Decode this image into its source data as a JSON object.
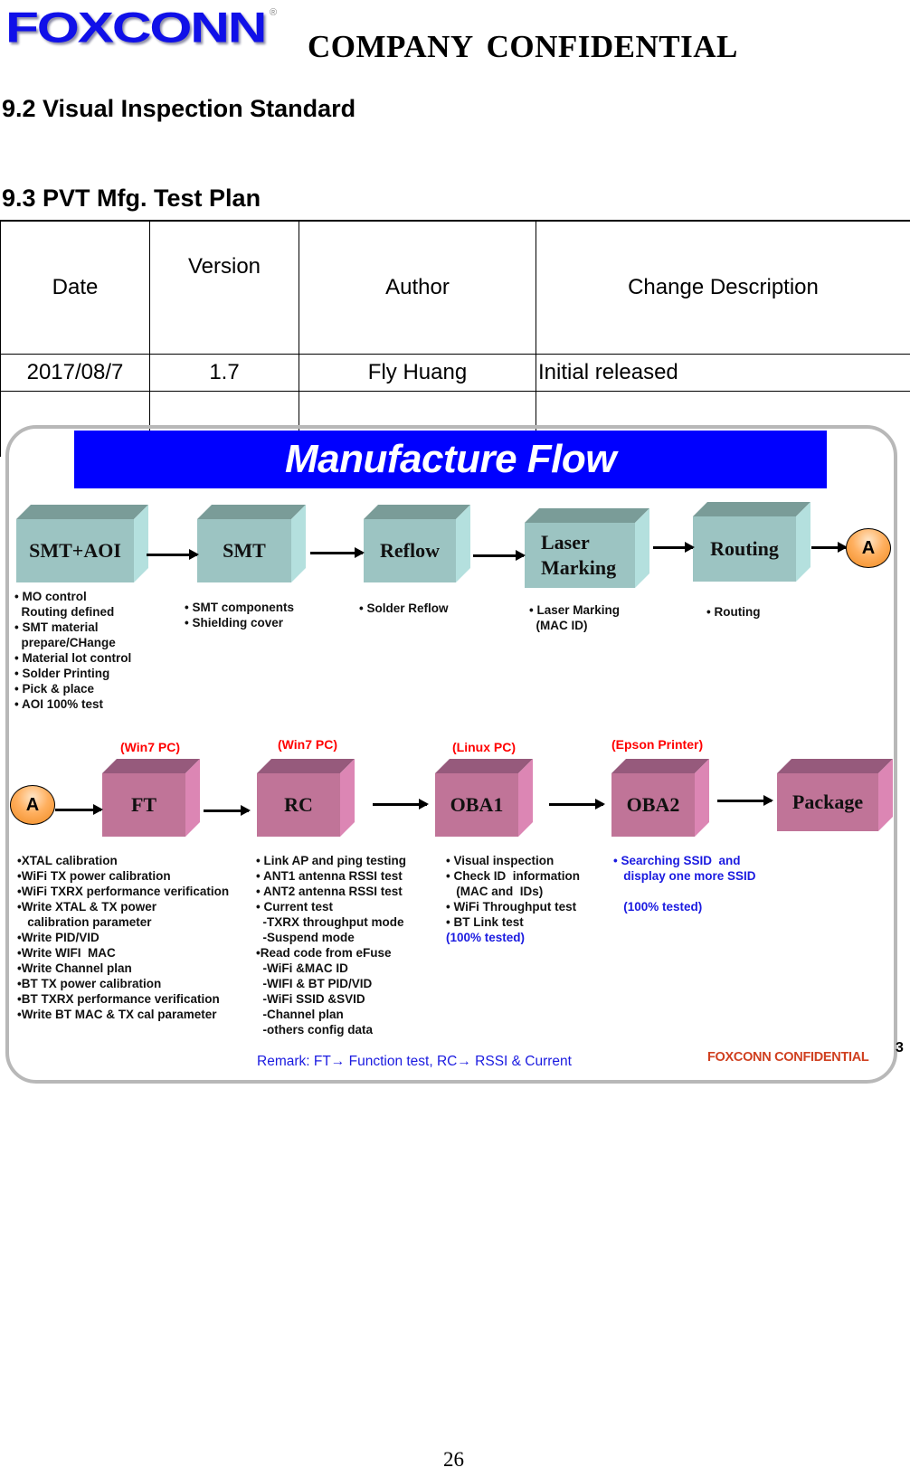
{
  "header": {
    "logo_text": "FOXCONN",
    "logo_registered": "®",
    "confidential_label": "COMPANY  CONFIDENTIAL"
  },
  "sections": {
    "visual_inspection_heading": "9.2 Visual Inspection Standard",
    "test_plan_heading": "9.3 PVT Mfg. Test Plan"
  },
  "revision_table": {
    "columns": [
      "Date",
      "Version",
      "Author",
      "Change Description"
    ],
    "rows": [
      [
        "2017/08/7",
        "1.7",
        "Fly Huang",
        "Initial released"
      ],
      [
        "",
        "",
        "",
        ""
      ]
    ]
  },
  "flow": {
    "title": "Manufacture Flow",
    "connector_label": "A",
    "row1": [
      {
        "label": "SMT+AOI",
        "notes": "• MO control\n  Routing defined\n• SMT material\n  prepare/CHange\n• Material lot control\n• Solder Printing\n• Pick & place\n• AOI 100% test"
      },
      {
        "label": "SMT",
        "notes": "• SMT components\n• Shielding cover"
      },
      {
        "label": "Reflow",
        "notes": "• Solder Reflow"
      },
      {
        "label": "Laser\nMarking",
        "notes": "• Laser Marking\n  (MAC ID)"
      },
      {
        "label": "Routing",
        "notes": "• Routing"
      }
    ],
    "row2": [
      {
        "label": "FT",
        "platform": "(Win7 PC)",
        "notes": "•XTAL calibration\n•WiFi TX power calibration\n•WiFi TXRX performance verification\n•Write XTAL & TX power\n   calibration parameter\n•Write PID/VID\n•Write WIFI  MAC\n•Write Channel plan\n•BT TX power calibration\n•BT TXRX performance verification\n•Write BT MAC & TX cal parameter"
      },
      {
        "label": "RC",
        "platform": "(Win7 PC)",
        "notes": "• Link AP and ping testing\n• ANT1 antenna RSSI test\n• ANT2 antenna RSSI test\n• Current test\n  -TXRX throughput mode\n  -Suspend mode\n•Read code from eFuse\n  -WiFi &MAC ID\n  -WIFI & BT PID/VID\n  -WiFi SSID &SVID\n  -Channel plan\n  -others config data"
      },
      {
        "label": "OBA1",
        "platform": "(Linux PC)",
        "notes": "• Visual inspection\n• Check ID  information\n   (MAC and  IDs)\n• WiFi Throughput test\n• BT Link test",
        "notes_tested": "(100% tested)"
      },
      {
        "label": "OBA2",
        "platform": "(Epson Printer)",
        "notes": "• Searching SSID  and\n   display one more SSID\n\n   (100% tested)"
      },
      {
        "label": "Package"
      }
    ],
    "remark": "Remark: FT→ Function test, RC→ RSSI & Current",
    "footer_confidential": "FOXCONN CONFIDENTIAL",
    "slide_number": "3"
  },
  "page_number": "26"
}
